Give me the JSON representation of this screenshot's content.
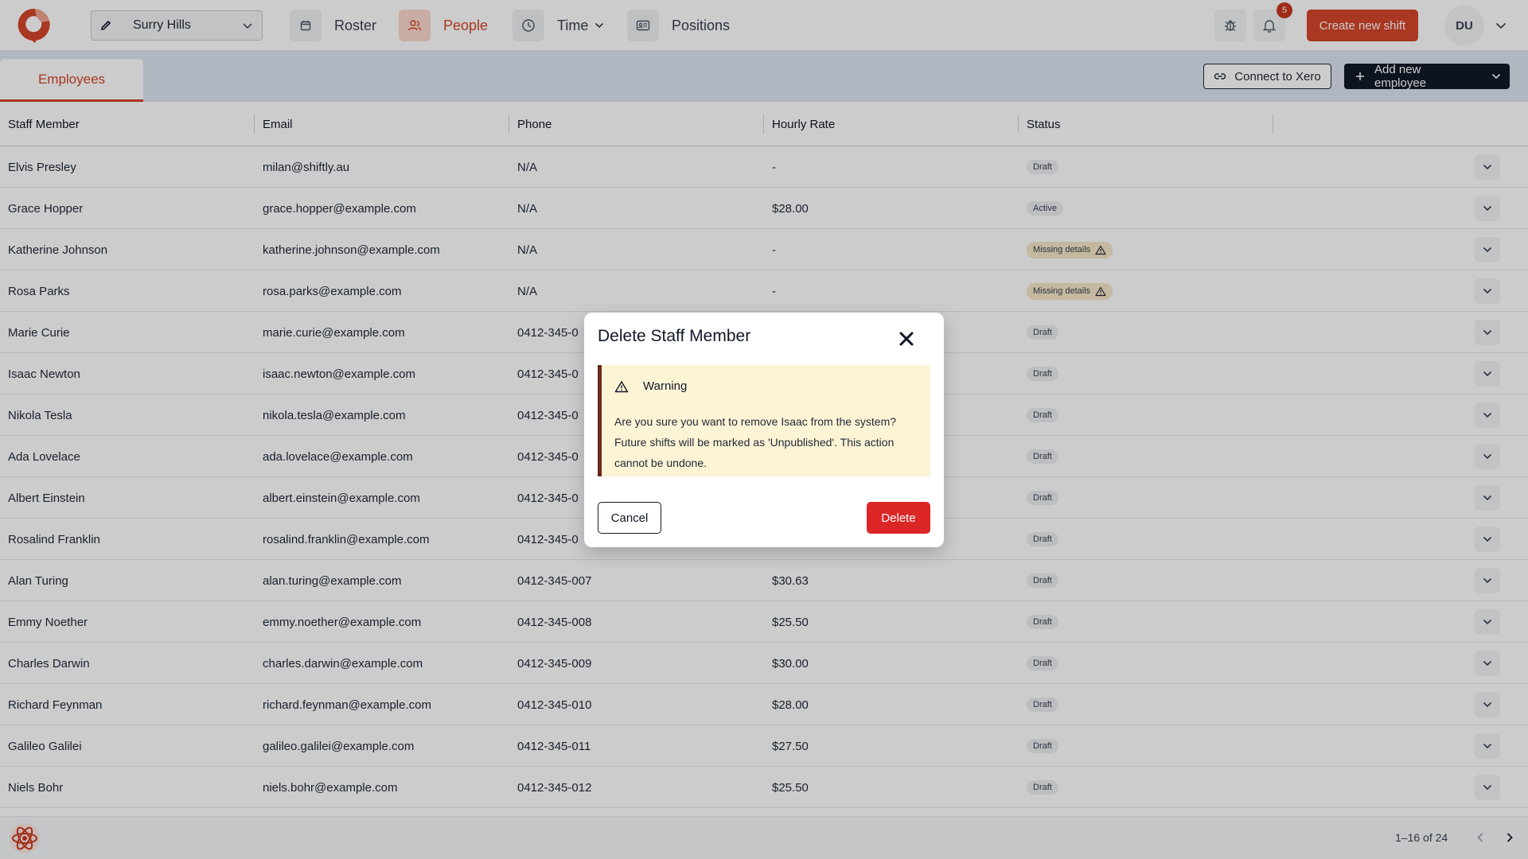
{
  "nav": {
    "location": "Surry Hills",
    "items": [
      {
        "label": "Roster",
        "icon": "calendar-icon"
      },
      {
        "label": "People",
        "icon": "people-icon",
        "active": true
      },
      {
        "label": "Time",
        "icon": "clock-icon",
        "has_dropdown": true
      },
      {
        "label": "Positions",
        "icon": "id-card-icon"
      }
    ],
    "notification_count": "5",
    "create_button": "Create new shift",
    "avatar_initials": "DU"
  },
  "subheader": {
    "tab": "Employees",
    "connect_button": "Connect to Xero",
    "add_button": "Add new employee"
  },
  "table": {
    "columns": [
      "Staff Member",
      "Email",
      "Phone",
      "Hourly Rate",
      "Status"
    ],
    "rows": [
      {
        "name": "Elvis Presley",
        "email": "milan@shiftly.au",
        "phone": "N/A",
        "rate": "-",
        "status": "Draft"
      },
      {
        "name": "Grace Hopper",
        "email": "grace.hopper@example.com",
        "phone": "N/A",
        "rate": "$28.00",
        "status": "Active"
      },
      {
        "name": "Katherine Johnson",
        "email": "katherine.johnson@example.com",
        "phone": "N/A",
        "rate": "-",
        "status": "Missing details"
      },
      {
        "name": "Rosa Parks",
        "email": "rosa.parks@example.com",
        "phone": "N/A",
        "rate": "-",
        "status": "Missing details"
      },
      {
        "name": "Marie Curie",
        "email": "marie.curie@example.com",
        "phone": "0412-345-0",
        "rate": "",
        "status": "Draft"
      },
      {
        "name": "Isaac Newton",
        "email": "isaac.newton@example.com",
        "phone": "0412-345-0",
        "rate": "",
        "status": "Draft"
      },
      {
        "name": "Nikola Tesla",
        "email": "nikola.tesla@example.com",
        "phone": "0412-345-0",
        "rate": "",
        "status": "Draft"
      },
      {
        "name": "Ada Lovelace",
        "email": "ada.lovelace@example.com",
        "phone": "0412-345-0",
        "rate": "",
        "status": "Draft"
      },
      {
        "name": "Albert Einstein",
        "email": "albert.einstein@example.com",
        "phone": "0412-345-0",
        "rate": "",
        "status": "Draft"
      },
      {
        "name": "Rosalind Franklin",
        "email": "rosalind.franklin@example.com",
        "phone": "0412-345-0",
        "rate": "",
        "status": "Draft"
      },
      {
        "name": "Alan Turing",
        "email": "alan.turing@example.com",
        "phone": "0412-345-007",
        "rate": "$30.63",
        "status": "Draft"
      },
      {
        "name": "Emmy Noether",
        "email": "emmy.noether@example.com",
        "phone": "0412-345-008",
        "rate": "$25.50",
        "status": "Draft"
      },
      {
        "name": "Charles Darwin",
        "email": "charles.darwin@example.com",
        "phone": "0412-345-009",
        "rate": "$30.00",
        "status": "Draft"
      },
      {
        "name": "Richard Feynman",
        "email": "richard.feynman@example.com",
        "phone": "0412-345-010",
        "rate": "$28.00",
        "status": "Draft"
      },
      {
        "name": "Galileo Galilei",
        "email": "galileo.galilei@example.com",
        "phone": "0412-345-011",
        "rate": "$27.50",
        "status": "Draft"
      },
      {
        "name": "Niels Bohr",
        "email": "niels.bohr@example.com",
        "phone": "0412-345-012",
        "rate": "$25.50",
        "status": "Draft"
      }
    ]
  },
  "footer": {
    "pagination": "1–16 of 24"
  },
  "modal": {
    "title": "Delete Staff Member",
    "warning_title": "Warning",
    "warning_text": "Are you sure you want to remove Isaac from the system? Future shifts will be marked as 'Unpublished'. This action cannot be undone.",
    "cancel": "Cancel",
    "delete": "Delete"
  },
  "colors": {
    "brand": "#d4452a",
    "danger": "#dc2626",
    "warning_bg": "#fdf3d5"
  }
}
